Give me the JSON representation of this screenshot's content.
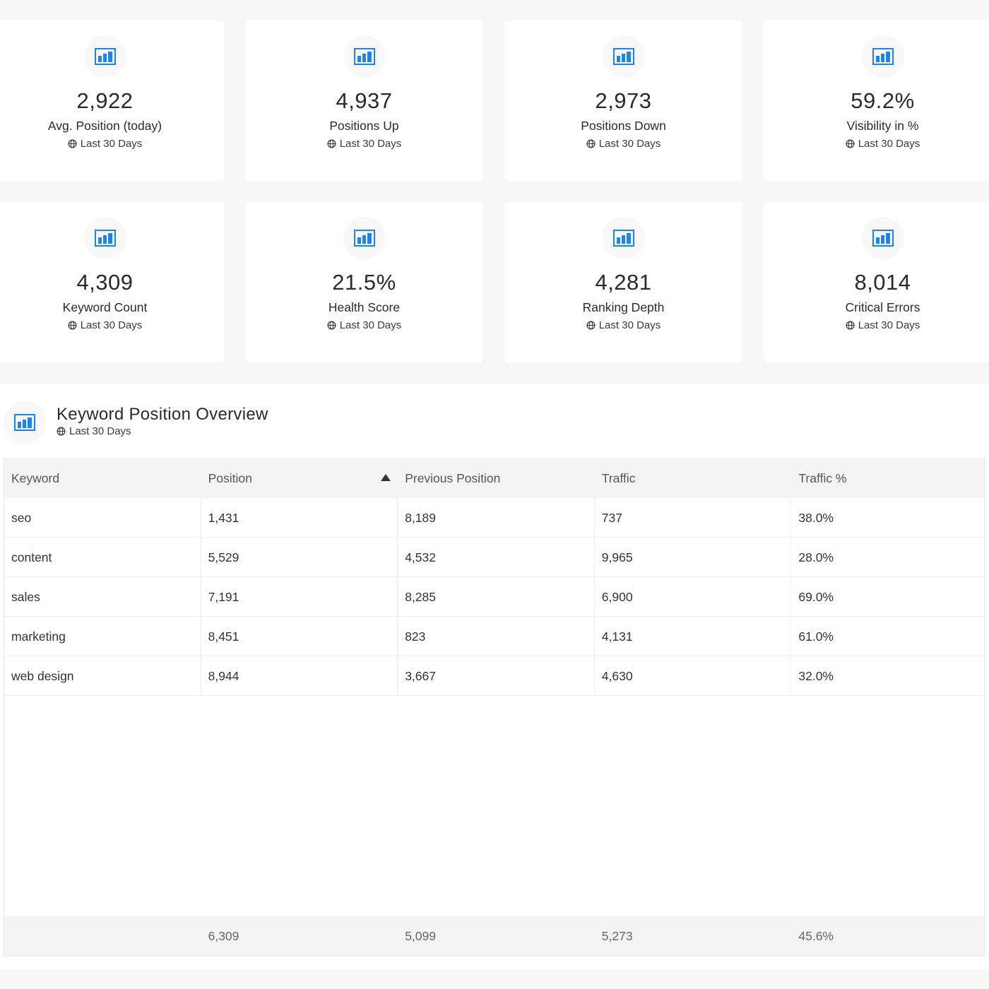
{
  "colors": {
    "accent": "#1a84f0",
    "card_bg": "#ffffff",
    "page_bg": "#f7f7f7"
  },
  "cards": [
    {
      "value": "2,922",
      "label": "Avg. Position (today)",
      "period": "Last 30 Days",
      "icon": "bar-chart-icon"
    },
    {
      "value": "4,937",
      "label": "Positions Up",
      "period": "Last 30 Days",
      "icon": "bar-chart-icon"
    },
    {
      "value": "2,973",
      "label": "Positions Down",
      "period": "Last 30 Days",
      "icon": "bar-chart-icon"
    },
    {
      "value": "59.2%",
      "label": "Visibility in %",
      "period": "Last 30 Days",
      "icon": "bar-chart-icon"
    },
    {
      "value": "4,309",
      "label": "Keyword Count",
      "period": "Last 30 Days",
      "icon": "bar-chart-icon"
    },
    {
      "value": "21.5%",
      "label": "Health Score",
      "period": "Last 30 Days",
      "icon": "bar-chart-icon"
    },
    {
      "value": "4,281",
      "label": "Ranking Depth",
      "period": "Last 30 Days",
      "icon": "bar-chart-icon"
    },
    {
      "value": "8,014",
      "label": "Critical Errors",
      "period": "Last 30 Days",
      "icon": "bar-chart-icon"
    }
  ],
  "panel": {
    "title": "Keyword Position Overview",
    "period": "Last 30 Days",
    "icon": "bar-chart-icon",
    "table": {
      "columns": [
        "Keyword",
        "Position",
        "Previous Position",
        "Traffic",
        "Traffic %"
      ],
      "sort_column": "Position",
      "sort_direction": "ascending",
      "rows": [
        [
          "seo",
          "1,431",
          "8,189",
          "737",
          "38.0%"
        ],
        [
          "content",
          "5,529",
          "4,532",
          "9,965",
          "28.0%"
        ],
        [
          "sales",
          "7,191",
          "8,285",
          "6,900",
          "69.0%"
        ],
        [
          "marketing",
          "8,451",
          "823",
          "4,131",
          "61.0%"
        ],
        [
          "web design",
          "8,944",
          "3,667",
          "4,630",
          "32.0%"
        ]
      ],
      "footer": [
        "",
        "6,309",
        "5,099",
        "5,273",
        "45.6%"
      ]
    }
  }
}
